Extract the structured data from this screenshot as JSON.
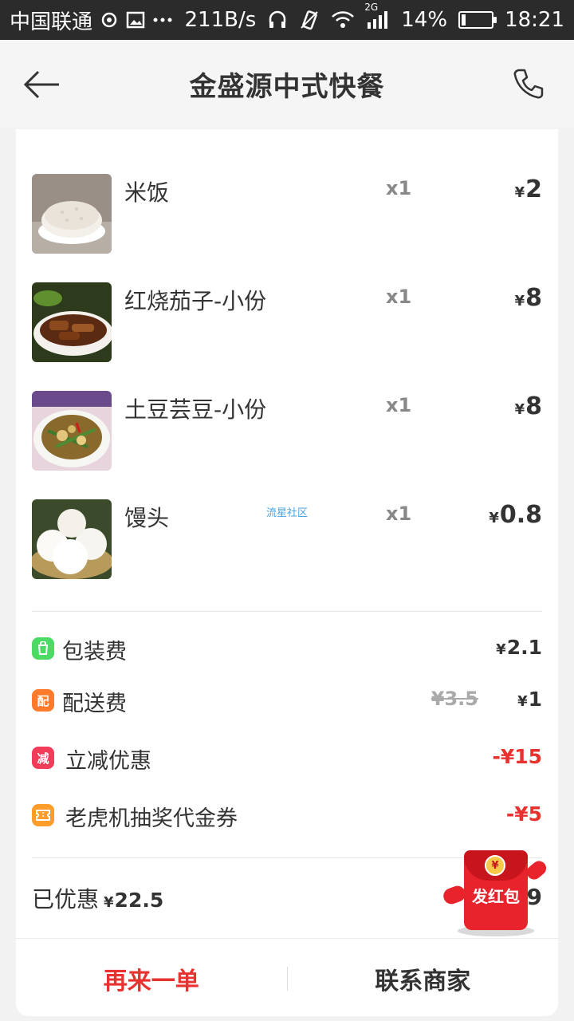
{
  "status_bar": {
    "carrier": "中国联通",
    "net_speed": "211B/s",
    "network_type": "2G",
    "battery": "14%",
    "battery_level": 0.14,
    "time": "18:21"
  },
  "header": {
    "title": "金盛源中式快餐"
  },
  "items": [
    {
      "name": "米饭",
      "qty": "x1",
      "price": "2"
    },
    {
      "name": "红烧茄子-小份",
      "qty": "x1",
      "price": "8"
    },
    {
      "name": "土豆芸豆-小份",
      "qty": "x1",
      "price": "8"
    },
    {
      "name": "馒头",
      "qty": "x1",
      "price": "0.8"
    }
  ],
  "watermark": "流星社区",
  "currency": "¥",
  "fees": {
    "packaging": {
      "label": "包装费",
      "icon": "bag-icon",
      "value": "2.1",
      "color": "#4cd964"
    },
    "delivery": {
      "label": "配送费",
      "icon_text": "配",
      "old_value": "¥3.5",
      "value": "1",
      "color": "#ff7a2a"
    },
    "discount": {
      "label": "立减优惠",
      "icon_text": "减",
      "value": "-¥15",
      "color": "#f23c5a"
    },
    "voucher": {
      "label": "老虎机抽奖代金券",
      "icon": "ticket-icon",
      "value": "-¥5",
      "color": "#ff9c2a"
    }
  },
  "summary": {
    "saved_label": "已优惠",
    "saved_amount": "22.5",
    "total_visible": ".9"
  },
  "red_packet": {
    "label": "发红包",
    "coin": "¥"
  },
  "actions": {
    "reorder": "再来一单",
    "contact": "联系商家"
  }
}
